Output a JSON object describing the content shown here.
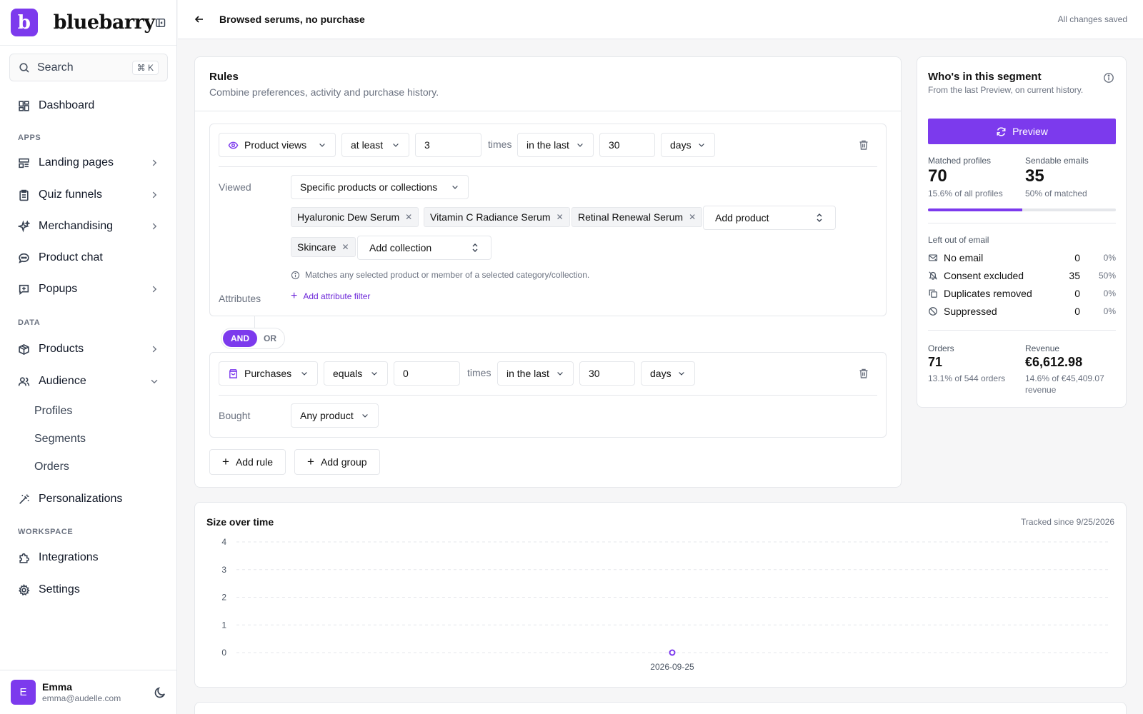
{
  "brand": {
    "logo_letter": "b",
    "name": "bluebarry"
  },
  "search": {
    "placeholder": "Search",
    "shortcut": "⌘ K"
  },
  "nav": {
    "dashboard": "Dashboard",
    "apps_label": "APPS",
    "landing_pages": "Landing pages",
    "quiz_funnels": "Quiz funnels",
    "merchandising": "Merchandising",
    "product_chat": "Product chat",
    "popups": "Popups",
    "data_label": "DATA",
    "products": "Products",
    "audience": "Audience",
    "audience_sub": [
      "Profiles",
      "Segments",
      "Orders"
    ],
    "personalizations": "Personalizations",
    "workspace_label": "WORKSPACE",
    "integrations": "Integrations",
    "settings": "Settings"
  },
  "user": {
    "initial": "E",
    "name": "Emma",
    "email": "emma@audelle.com"
  },
  "header": {
    "title": "Browsed serums, no purchase",
    "status": "All changes saved"
  },
  "rules": {
    "title": "Rules",
    "subtitle": "Combine preferences, activity and purchase history.",
    "rule1": {
      "metric": "Product views",
      "operator": "at least",
      "count": "3",
      "times": "times",
      "window": "in the last",
      "window_value": "30",
      "unit": "days",
      "viewed_label": "Viewed",
      "scope": "Specific products or collections",
      "products": [
        "Hyaluronic Dew Serum",
        "Vitamin C Radiance Serum",
        "Retinal Renewal Serum"
      ],
      "add_product": "Add product",
      "collections": [
        "Skincare"
      ],
      "add_collection": "Add collection",
      "hint": "Matches any selected product or member of a selected category/collection.",
      "attributes_label": "Attributes",
      "add_attribute": "Add attribute filter"
    },
    "logic": {
      "and": "AND",
      "or": "OR"
    },
    "rule2": {
      "metric": "Purchases",
      "operator": "equals",
      "count": "0",
      "times": "times",
      "window": "in the last",
      "window_value": "30",
      "unit": "days",
      "bought_label": "Bought",
      "scope": "Any product"
    },
    "add_rule": "Add rule",
    "add_group": "Add group"
  },
  "segment": {
    "title": "Who's in this segment",
    "subtitle": "From the last Preview, on current history.",
    "preview": "Preview",
    "matched_label": "Matched profiles",
    "matched_value": "70",
    "matched_note": "15.6% of all profiles",
    "sendable_label": "Sendable emails",
    "sendable_value": "35",
    "sendable_note": "50% of matched",
    "sendable_fraction": 0.5,
    "left_out_label": "Left out of email",
    "left_out": [
      {
        "label": "No email",
        "count": "0",
        "pct": "0%",
        "icon": "mail-x-icon"
      },
      {
        "label": "Consent excluded",
        "count": "35",
        "pct": "50%",
        "icon": "bell-off-icon"
      },
      {
        "label": "Duplicates removed",
        "count": "0",
        "pct": "0%",
        "icon": "copy-icon"
      },
      {
        "label": "Suppressed",
        "count": "0",
        "pct": "0%",
        "icon": "ban-icon"
      }
    ],
    "orders_label": "Orders",
    "orders_value": "71",
    "orders_note": "13.1% of 544 orders",
    "revenue_label": "Revenue",
    "revenue_value": "€6,612.98",
    "revenue_note": "14.6% of €45,409.07 revenue"
  },
  "chart": {
    "title": "Size over time",
    "note": "Tracked since 9/25/2026"
  },
  "chart_data": {
    "type": "line",
    "title": "Size over time",
    "x": [
      "2026-09-25"
    ],
    "series": [
      {
        "values": [
          0
        ]
      }
    ],
    "ylim": [
      0,
      4
    ],
    "yticks": [
      0,
      1,
      2,
      3,
      4
    ],
    "grid": true,
    "color": "#7c3aed"
  },
  "colors": {
    "accent": "#7c3aed"
  }
}
